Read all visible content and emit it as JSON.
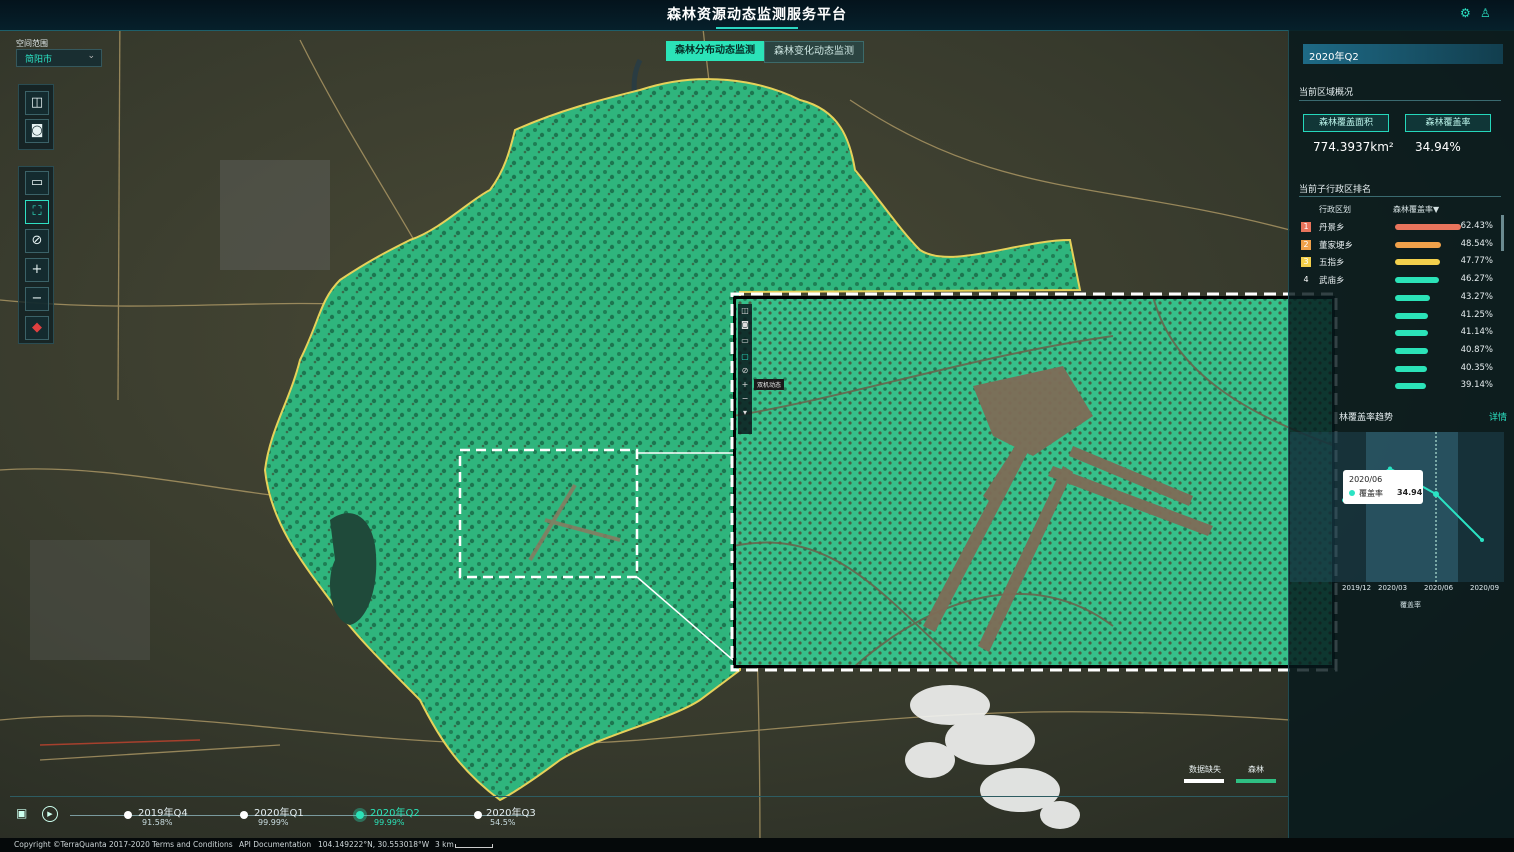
{
  "app": {
    "title": "森林资源动态监测服务平台"
  },
  "region_selector": {
    "label": "空间范围",
    "value": "简阳市"
  },
  "mode_tabs": [
    {
      "label": "森林分布动态监测",
      "active": true
    },
    {
      "label": "森林变化动态监测",
      "active": false
    }
  ],
  "right_panel": {
    "period": "2020年Q2",
    "overview_title": "当前区域概况",
    "forest_area_label": "森林覆盖面积",
    "forest_rate_label": "森林覆盖率",
    "forest_area_value": "774.3937km²",
    "forest_rate_value": "34.94%",
    "ranking_title": "当前子行政区排名",
    "rank_col_district": "行政区划",
    "rank_col_rate": "森林覆盖率▼",
    "ranking": [
      {
        "rank": "1",
        "name": "丹景乡",
        "rate": "62.43%",
        "value": 62.43,
        "color": "#e8745c"
      },
      {
        "rank": "2",
        "name": "董家埂乡",
        "rate": "48.54%",
        "value": 48.54,
        "color": "#f0a14a"
      },
      {
        "rank": "3",
        "name": "五指乡",
        "rate": "47.77%",
        "value": 47.77,
        "color": "#f3d04c"
      },
      {
        "rank": "4",
        "name": "武庙乡",
        "rate": "46.27%",
        "value": 46.27,
        "color": "#2be3b8"
      },
      {
        "rank": "",
        "name": "",
        "rate": "43.27%",
        "value": 43.27,
        "color": "#2be3b8"
      },
      {
        "rank": "",
        "name": "",
        "rate": "41.25%",
        "value": 41.25,
        "color": "#2be3b8"
      },
      {
        "rank": "",
        "name": "",
        "rate": "41.14%",
        "value": 41.14,
        "color": "#2be3b8"
      },
      {
        "rank": "",
        "name": "",
        "rate": "40.87%",
        "value": 40.87,
        "color": "#2be3b8"
      },
      {
        "rank": "",
        "name": "",
        "rate": "40.35%",
        "value": 40.35,
        "color": "#2be3b8"
      },
      {
        "rank": "",
        "name": "",
        "rate": "39.14%",
        "value": 39.14,
        "color": "#2be3b8"
      }
    ],
    "trend_title": "林覆盖率趋势",
    "trend_detail": "详情",
    "chart_data": {
      "type": "line",
      "x": [
        "2019/12",
        "2020/03",
        "2020/06",
        "2020/09"
      ],
      "series": [
        {
          "name": "覆盖率",
          "values": [
            34.5,
            36.8,
            34.94,
            31.6
          ]
        }
      ],
      "xlabel": "覆盖率",
      "ylim": [
        30,
        38
      ],
      "tooltip": {
        "date": "2020/06",
        "series": "覆盖率",
        "value": "34.94"
      }
    }
  },
  "timeline": [
    {
      "label": "2019年Q4",
      "sub": "91.58%",
      "active": false
    },
    {
      "label": "2020年Q1",
      "sub": "99.99%",
      "active": false
    },
    {
      "label": "2020年Q2",
      "sub": "99.99%",
      "active": true
    },
    {
      "label": "2020年Q3",
      "sub": "54.5%",
      "active": false
    }
  ],
  "legend": {
    "missing": "数据缺失",
    "forest": "森林"
  },
  "inset_tooltip": "双机动态",
  "footer": {
    "copyright": "Copyright ©TerraQuanta 2017-2020",
    "terms": "Terms and Conditions",
    "api": "API Documentation",
    "coords": "104.149222°N, 30.553018°W",
    "scale": "3 km"
  },
  "colors": {
    "accent": "#2be3c4",
    "forest": "#2fbf83",
    "boundary": "#e6d15a"
  }
}
